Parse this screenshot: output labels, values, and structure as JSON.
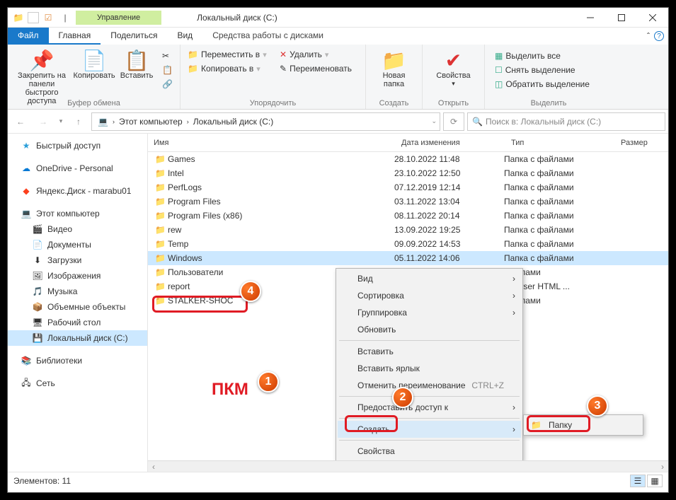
{
  "title": "Локальный диск (C:)",
  "manage_tab": "Управление",
  "tabs": {
    "file": "Файл",
    "home": "Главная",
    "share": "Поделиться",
    "view": "Вид",
    "drive": "Средства работы с дисками"
  },
  "ribbon": {
    "pin": "Закрепить на панели\nбыстрого доступа",
    "copy": "Копировать",
    "paste": "Вставить",
    "grp_clip": "Буфер обмена",
    "move": "Переместить в",
    "copyto": "Копировать в",
    "delete": "Удалить",
    "rename": "Переименовать",
    "grp_org": "Упорядочить",
    "newfolder": "Новая\nпапка",
    "grp_new": "Создать",
    "props": "Свойства",
    "grp_open": "Открыть",
    "selectall": "Выделить все",
    "selectnone": "Снять выделение",
    "invert": "Обратить выделение",
    "grp_sel": "Выделить"
  },
  "breadcrumb": [
    "Этот компьютер",
    "Локальный диск (C:)"
  ],
  "search_placeholder": "Поиск в: Локальный диск (C:)",
  "nav": {
    "quick": "Быстрый доступ",
    "onedrive": "OneDrive - Personal",
    "yandex": "Яндекс.Диск - marabu01",
    "pc": "Этот компьютер",
    "videos": "Видео",
    "docs": "Документы",
    "downloads": "Загрузки",
    "pictures": "Изображения",
    "music": "Музыка",
    "objects3d": "Объемные объекты",
    "desktop": "Рабочий стол",
    "drive_c": "Локальный диск (C:)",
    "libraries": "Библиотеки",
    "network": "Сеть"
  },
  "columns": {
    "name": "Имя",
    "date": "Дата изменения",
    "type": "Тип",
    "size": "Размер"
  },
  "files": [
    {
      "name": "Games",
      "date": "28.10.2022 11:48",
      "type": "Папка с файлами"
    },
    {
      "name": "Intel",
      "date": "23.10.2022 12:50",
      "type": "Папка с файлами"
    },
    {
      "name": "PerfLogs",
      "date": "07.12.2019 12:14",
      "type": "Папка с файлами"
    },
    {
      "name": "Program Files",
      "date": "03.11.2022 13:04",
      "type": "Папка с файлами"
    },
    {
      "name": "Program Files (x86)",
      "date": "08.11.2022 20:14",
      "type": "Папка с файлами"
    },
    {
      "name": "rew",
      "date": "13.09.2022 19:25",
      "type": "Папка с файлами"
    },
    {
      "name": "Temp",
      "date": "09.09.2022 14:53",
      "type": "Папка с файлами"
    },
    {
      "name": "Windows",
      "date": "05.11.2022 14:06",
      "type": "Папка с файлами"
    },
    {
      "name": "Пользователи",
      "date": "",
      "type": "файлами"
    },
    {
      "name": "report",
      "date": "",
      "type": "Browser HTML ..."
    },
    {
      "name": "STALKER-SHOC",
      "date": "",
      "type": "файлами"
    }
  ],
  "ctx": {
    "view": "Вид",
    "sort": "Сортировка",
    "group": "Группировка",
    "refresh": "Обновить",
    "paste": "Вставить",
    "pastelink": "Вставить ярлык",
    "undo": "Отменить переименование",
    "undo_sc": "CTRL+Z",
    "access": "Предоставить доступ к",
    "create": "Создать",
    "props": "Свойства",
    "folder": "Папку"
  },
  "status": "Элементов: 11",
  "anno_text": "ПКМ"
}
